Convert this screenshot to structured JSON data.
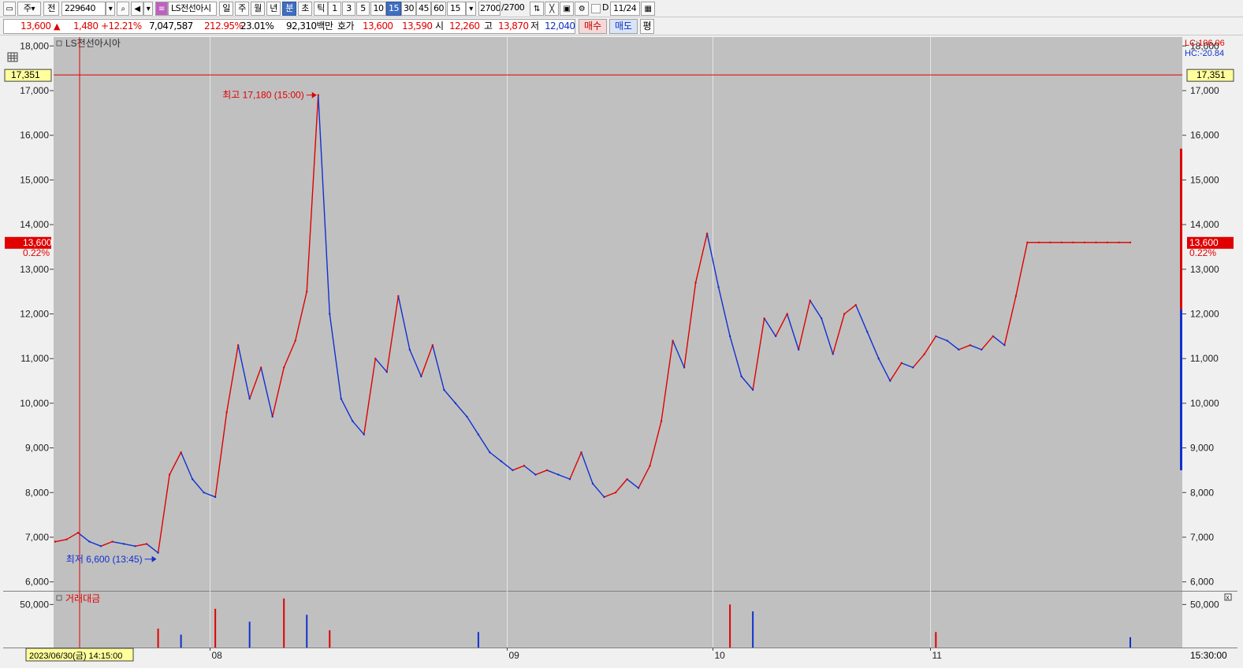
{
  "toolbar": {
    "market": "주",
    "prev_label": "전",
    "code": "229640",
    "name": "LS전선아시",
    "periods": [
      "일",
      "주",
      "월",
      "년",
      "분",
      "초",
      "틱"
    ],
    "selected_period": "분",
    "intervals": [
      "1",
      "3",
      "5",
      "10",
      "15",
      "30",
      "45",
      "60"
    ],
    "selected_interval": "15",
    "interval_value": "15",
    "count": "2700",
    "count_total": "/2700",
    "d_label": "D",
    "date": "11/24",
    "icons": [
      "layout-icon",
      "search-icon",
      "sound-icon",
      "sound-dropdown-icon",
      "compare-icon",
      "stock-info-icon",
      "indicator-icon",
      "drawing-icon",
      "save-icon",
      "settings-icon",
      "checkbox-icon",
      "calendar-icon"
    ]
  },
  "quote": {
    "price": "13,600",
    "change_arrow": "▲",
    "change": "1,480",
    "change_pct": "+12.21%",
    "volume": "7,047,587",
    "volume_ratio": "212.95%",
    "turnover": "23.01%",
    "amount": "92,310백만",
    "bid_label": "호가",
    "ask": "13,600",
    "bid": "13,590",
    "open_label": "시",
    "open": "12,260",
    "high_label": "고",
    "high": "13,870",
    "low_label": "저",
    "low": "12,040",
    "buy_label": "매수",
    "sell_label": "매도",
    "eval_label": "평"
  },
  "chart_data": [
    {
      "type": "line",
      "title": "LS전선아시아",
      "ylim": [
        5800,
        18200
      ],
      "yticks": [
        "18,000",
        "17,000",
        "16,000",
        "15,000",
        "14,000",
        "13,000",
        "12,000",
        "11,000",
        "10,000",
        "9,000",
        "8,000",
        "7,000",
        "6,000"
      ],
      "ytick_values": [
        18000,
        17000,
        16000,
        15000,
        14000,
        13000,
        12000,
        11000,
        10000,
        9000,
        8000,
        7000,
        6000
      ],
      "xticks": [
        "08",
        "09",
        "10",
        "11"
      ],
      "crosshair_price": "17,351",
      "crosshair_price_value": 17351,
      "current_price": "13,600",
      "current_price_value": 13600,
      "current_pct": "0.22%",
      "lc_label": "LC:106.06",
      "hc_label": "HC:-20.84",
      "max_annotation": "최고 17,180 (15:00)",
      "min_annotation": "최저 6,600 (13:45)",
      "crosshair_time": "2023/06/30(금) 14:15:00",
      "last_time": "15:30:00",
      "colors": {
        "up": "#e00000",
        "down": "#1030d0",
        "background": "#c0c0c0"
      },
      "series": [
        {
          "x": [
            "06/30",
            "07/03",
            "07/06",
            "07/10",
            "07/13",
            "07/17",
            "07/20",
            "07/24",
            "07/26",
            "07/27",
            "07/27",
            "07/28",
            "07/31",
            "07/31",
            "08/01",
            "08/01",
            "08/02",
            "08/03",
            "08/04",
            "08/07",
            "08/08",
            "08/08",
            "08/09",
            "08/09",
            "08/10",
            "08/11",
            "08/14",
            "08/16",
            "08/17",
            "08/18",
            "08/21",
            "08/21",
            "08/22",
            "08/23",
            "08/24",
            "08/25",
            "08/28",
            "08/29",
            "08/30",
            "08/31",
            "09/01",
            "09/04",
            "09/05",
            "09/06",
            "09/07",
            "09/08",
            "09/11",
            "09/12",
            "09/13",
            "09/14",
            "09/15",
            "09/18",
            "09/19",
            "09/20",
            "09/21",
            "09/22",
            "09/25",
            "09/26",
            "10/04",
            "10/05",
            "10/06",
            "10/10",
            "10/11",
            "10/12",
            "10/13",
            "10/16",
            "10/17",
            "10/18",
            "10/19",
            "10/20",
            "10/23",
            "10/24",
            "10/25",
            "10/26",
            "10/27",
            "10/30",
            "10/31",
            "11/01",
            "11/02",
            "11/03",
            "11/06",
            "11/07",
            "11/08",
            "11/09",
            "11/10",
            "11/13",
            "11/14",
            "11/15",
            "11/16",
            "11/17",
            "11/20",
            "11/21",
            "11/22",
            "11/23",
            "11/24"
          ],
          "values": [
            6900,
            6950,
            7100,
            6900,
            6800,
            6900,
            6850,
            6800,
            6850,
            6650,
            8400,
            8900,
            8300,
            8000,
            7900,
            9800,
            11300,
            10100,
            10800,
            9700,
            10800,
            11400,
            12500,
            16900,
            12000,
            10100,
            9600,
            9300,
            11000,
            10700,
            12400,
            11200,
            10600,
            11300,
            10300,
            10000,
            9700,
            9300,
            8900,
            8700,
            8500,
            8600,
            8400,
            8500,
            8400,
            8300,
            8900,
            8200,
            7900,
            8000,
            8300,
            8100,
            8600,
            9600,
            11400,
            10800,
            12700,
            13800,
            12600,
            11500,
            10600,
            10300,
            11900,
            11500,
            12000,
            11200,
            12300,
            11900,
            11100,
            12000,
            12200,
            11600,
            11000,
            10500,
            10900,
            10800,
            11100,
            11500,
            11400,
            11200,
            11300,
            11200,
            11500,
            11300,
            12400,
            13600,
            13600,
            13600,
            13600,
            13600,
            13600,
            13600,
            13600,
            13600,
            13600
          ]
        }
      ]
    },
    {
      "type": "bar",
      "title": "거래대금",
      "ytick": "50,000",
      "ytick_value": 50000,
      "ylim": [
        0,
        65000
      ],
      "spikes": [
        {
          "x": "07/27",
          "value": 22000
        },
        {
          "x": "07/28",
          "value": 15000
        },
        {
          "x": "08/01",
          "value": 45000
        },
        {
          "x": "08/03",
          "value": 30000
        },
        {
          "x": "08/08",
          "value": 57000
        },
        {
          "x": "08/09",
          "value": 38000
        },
        {
          "x": "08/10",
          "value": 20000
        },
        {
          "x": "08/29",
          "value": 18000
        },
        {
          "x": "10/05",
          "value": 50000
        },
        {
          "x": "10/10",
          "value": 42000
        },
        {
          "x": "11/01",
          "value": 18000
        },
        {
          "x": "11/24",
          "value": 12000
        }
      ]
    }
  ]
}
